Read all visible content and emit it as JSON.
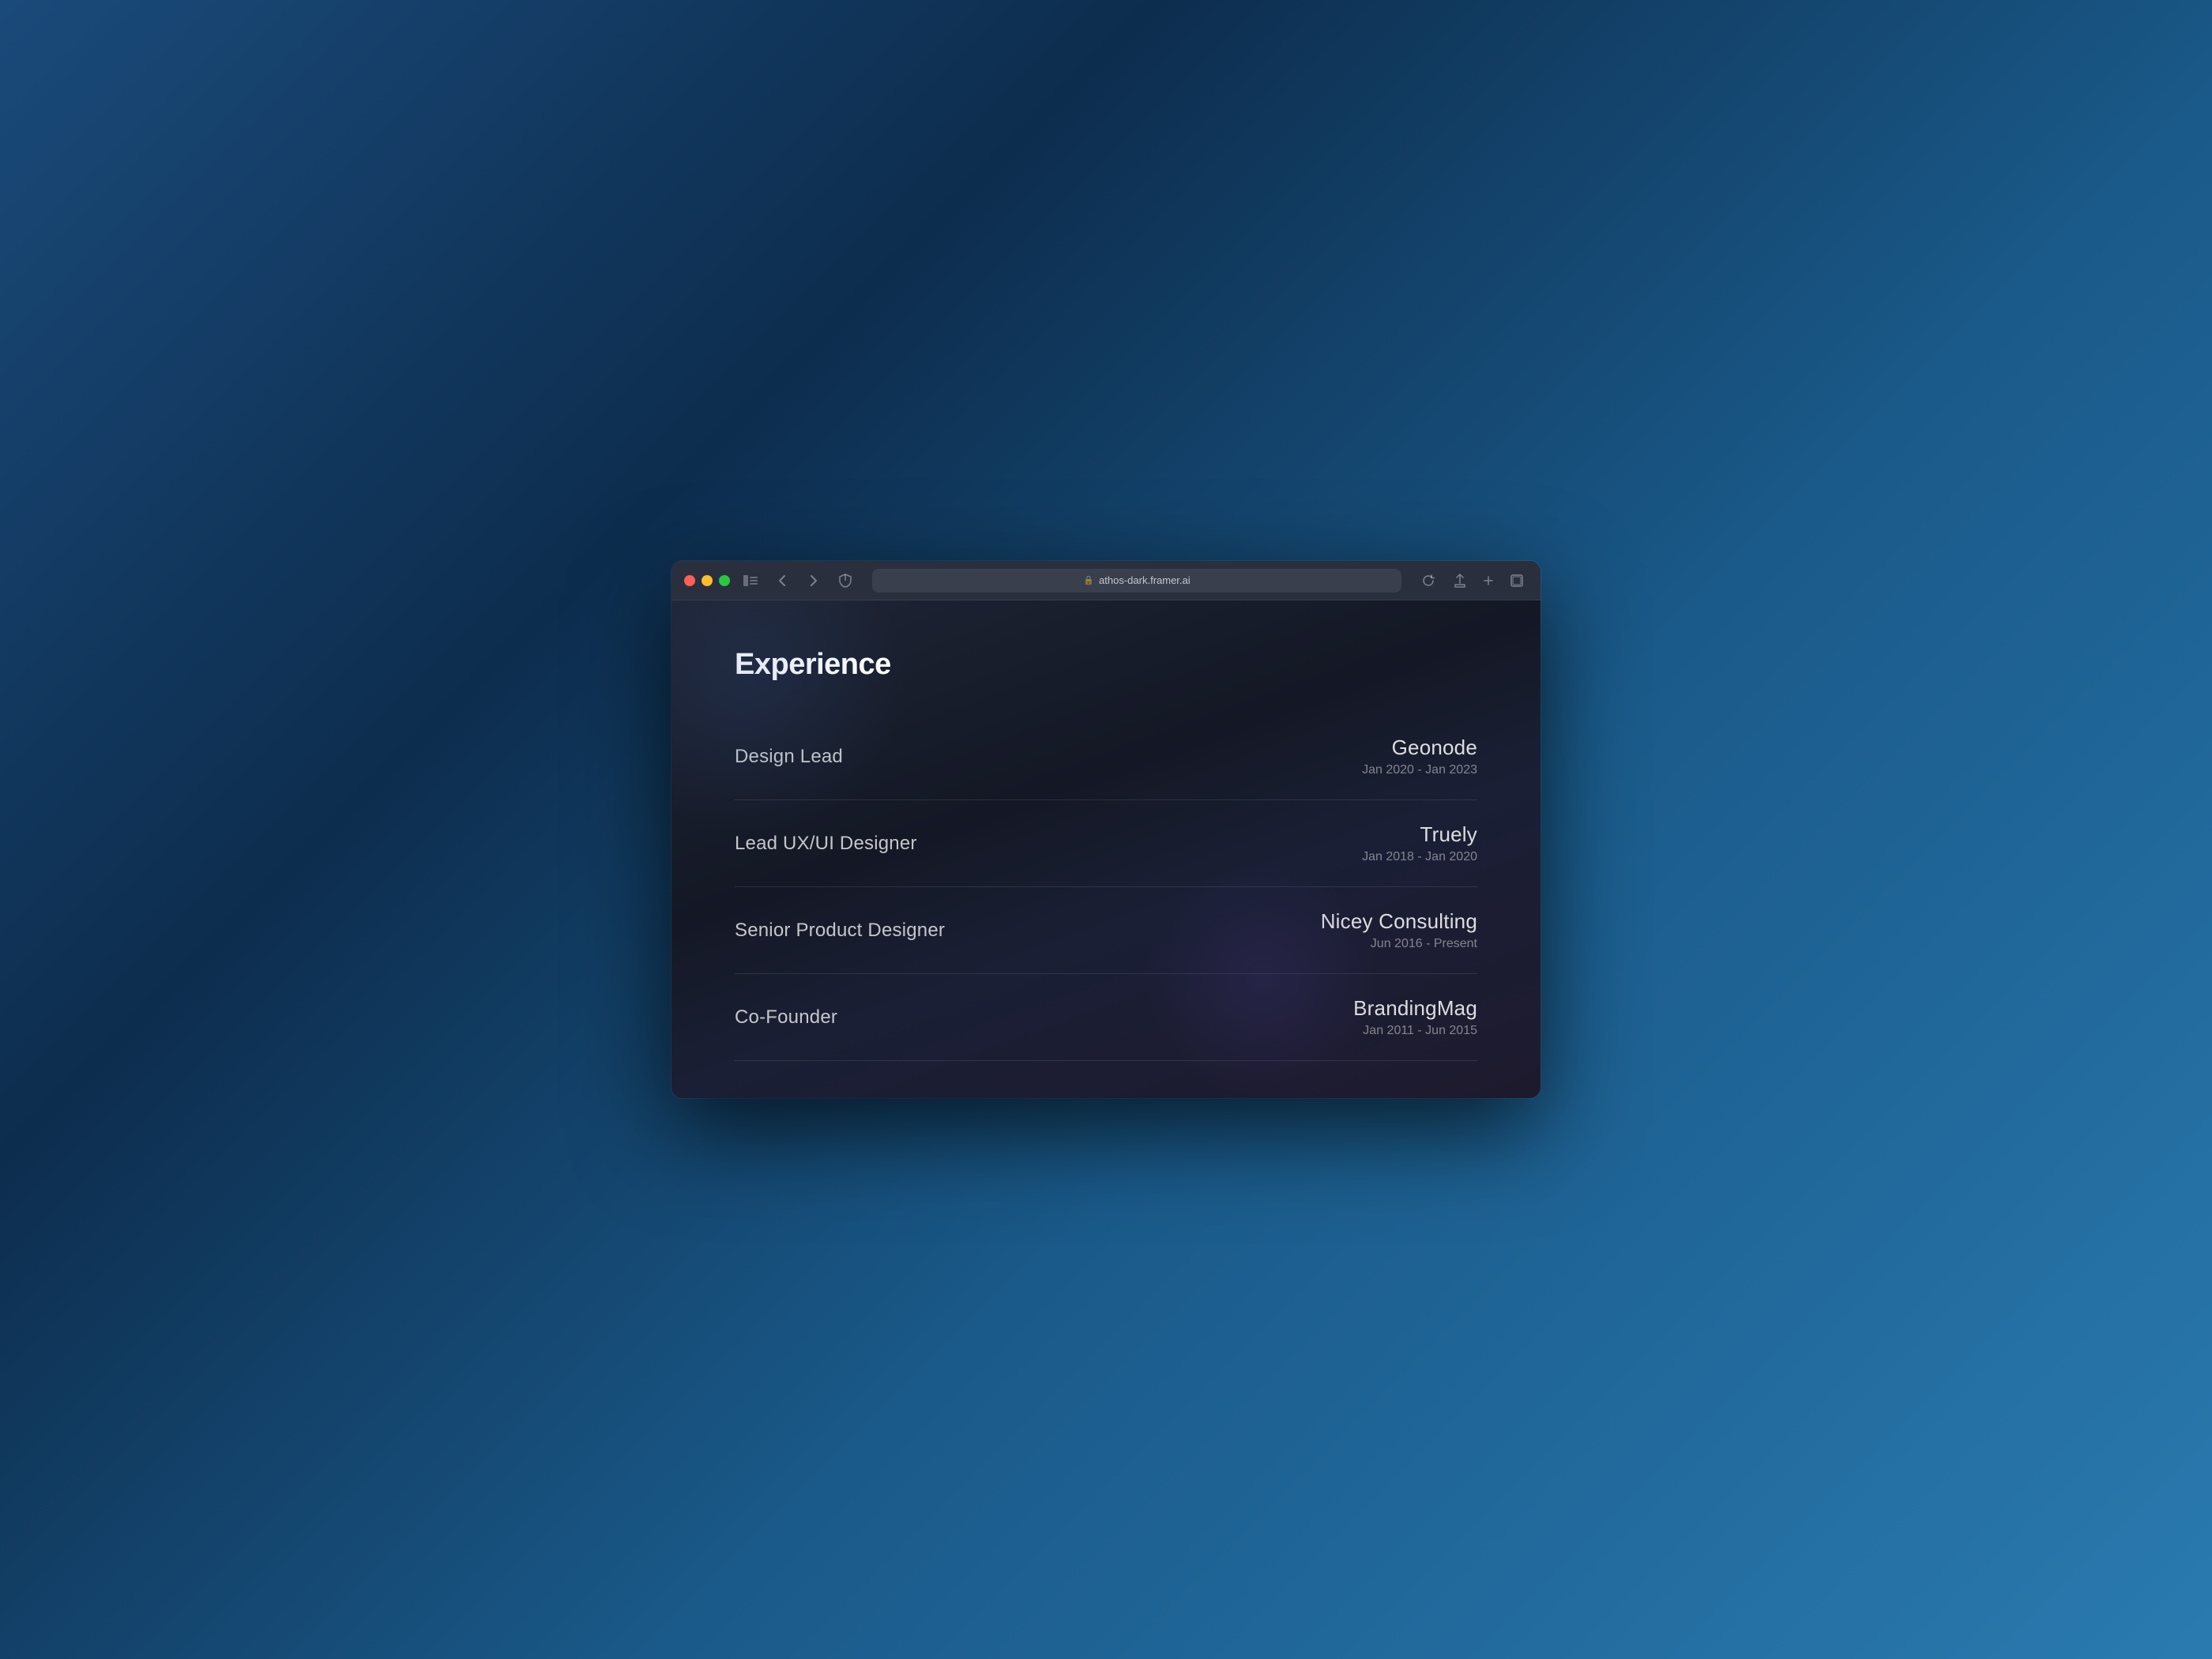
{
  "browser": {
    "url": "athos-dark.framer.ai",
    "tab_title": "athos-dark.framer.ai"
  },
  "page": {
    "section_title": "Experience",
    "experience_items": [
      {
        "job_title": "Design Lead",
        "company": "Geonode",
        "date_range": "Jan 2020 - Jan 2023"
      },
      {
        "job_title": "Lead UX/UI Designer",
        "company": "Truely",
        "date_range": "Jan 2018 - Jan 2020"
      },
      {
        "job_title": "Senior Product Designer",
        "company": "Nicey Consulting",
        "date_range": "Jun 2016 - Present"
      },
      {
        "job_title": "Co-Founder",
        "company": "BrandingMag",
        "date_range": "Jan 2011 - Jun 2015"
      }
    ]
  },
  "controls": {
    "back": "‹",
    "forward": "›",
    "reload": "↻",
    "share": "⬆",
    "new_tab": "+",
    "tabs": "⧉"
  }
}
